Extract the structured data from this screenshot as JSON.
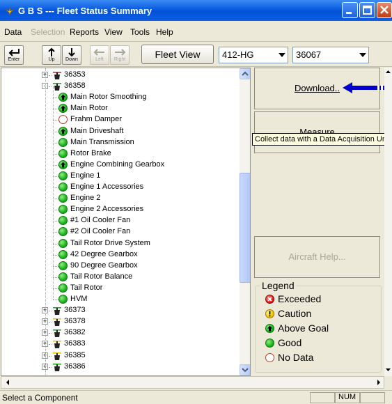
{
  "window": {
    "title": "G B S --- Fleet Status Summary"
  },
  "menu": {
    "items": [
      {
        "label": "Data",
        "disabled": false
      },
      {
        "label": "Selection",
        "disabled": true
      },
      {
        "label": "Reports",
        "disabled": false
      },
      {
        "label": "View",
        "disabled": false
      },
      {
        "label": "Tools",
        "disabled": false
      },
      {
        "label": "Help",
        "disabled": false
      }
    ]
  },
  "toolbar": {
    "enter": "Enter",
    "up": "Up",
    "down": "Down",
    "left": "Left",
    "right": "Right",
    "fleet_view": "Fleet View",
    "aircraft_type": "412-HG",
    "tail_number": "36067"
  },
  "tree": {
    "items": [
      {
        "label": "36353",
        "level": 0,
        "expander": "+",
        "icon": "helicopter-icon",
        "status": "exceeded"
      },
      {
        "label": "36358",
        "level": 0,
        "expander": "-",
        "icon": "helicopter-icon",
        "status": "above"
      },
      {
        "label": "Main Rotor Smoothing",
        "level": 1,
        "status": "above"
      },
      {
        "label": "Main Rotor",
        "level": 1,
        "status": "above"
      },
      {
        "label": "Frahm Damper",
        "level": 1,
        "status": "nodata"
      },
      {
        "label": "Main Driveshaft",
        "level": 1,
        "status": "above"
      },
      {
        "label": "Main Transmission",
        "level": 1,
        "status": "good"
      },
      {
        "label": "Rotor Brake",
        "level": 1,
        "status": "good"
      },
      {
        "label": "Engine Combining Gearbox",
        "level": 1,
        "status": "above"
      },
      {
        "label": "Engine 1",
        "level": 1,
        "status": "good"
      },
      {
        "label": "Engine 1 Accessories",
        "level": 1,
        "status": "good"
      },
      {
        "label": "Engine 2",
        "level": 1,
        "status": "good"
      },
      {
        "label": "Engine 2 Accessories",
        "level": 1,
        "status": "good"
      },
      {
        "label": "#1 Oil Cooler Fan",
        "level": 1,
        "status": "good"
      },
      {
        "label": "#2 Oil Cooler Fan",
        "level": 1,
        "status": "good"
      },
      {
        "label": "Tail Rotor Drive System",
        "level": 1,
        "status": "good"
      },
      {
        "label": "42 Degree Gearbox",
        "level": 1,
        "status": "good"
      },
      {
        "label": "90 Degree Gearbox",
        "level": 1,
        "status": "good"
      },
      {
        "label": "Tail Rotor Balance",
        "level": 1,
        "status": "good"
      },
      {
        "label": "Tail Rotor",
        "level": 1,
        "status": "good"
      },
      {
        "label": "HVM",
        "level": 1,
        "status": "good"
      },
      {
        "label": "36373",
        "level": 0,
        "expander": "+",
        "icon": "helicopter-icon",
        "status": "above"
      },
      {
        "label": "36378",
        "level": 0,
        "expander": "+",
        "icon": "helicopter-icon",
        "status": "caution"
      },
      {
        "label": "36382",
        "level": 0,
        "expander": "+",
        "icon": "helicopter-icon",
        "status": "above"
      },
      {
        "label": "36383",
        "level": 0,
        "expander": "+",
        "icon": "helicopter-icon",
        "status": "caution"
      },
      {
        "label": "36385",
        "level": 0,
        "expander": "+",
        "icon": "helicopter-icon",
        "status": "caution"
      },
      {
        "label": "36386",
        "level": 0,
        "expander": "+",
        "icon": "helicopter-icon",
        "status": "above"
      }
    ]
  },
  "right": {
    "download_label": "Download..",
    "measure_label": "Measure",
    "tooltip": "Collect data with a Data Acquisition Unit",
    "aircraft_help": "Aircraft Help..."
  },
  "legend": {
    "title": "Legend",
    "items": [
      {
        "label": "Exceeded",
        "status": "exceeded"
      },
      {
        "label": "Caution",
        "status": "caution"
      },
      {
        "label": "Above Goal",
        "status": "above"
      },
      {
        "label": "Good",
        "status": "good"
      },
      {
        "label": "No Data",
        "status": "nodata"
      }
    ]
  },
  "status": {
    "text": "Select a Component",
    "num": "NUM"
  },
  "colors": {
    "titlebar": "#0a5be0",
    "arrow": "#0000cc",
    "good": "#1fb21f",
    "exceeded": "#e02020",
    "caution": "#f3c800"
  }
}
